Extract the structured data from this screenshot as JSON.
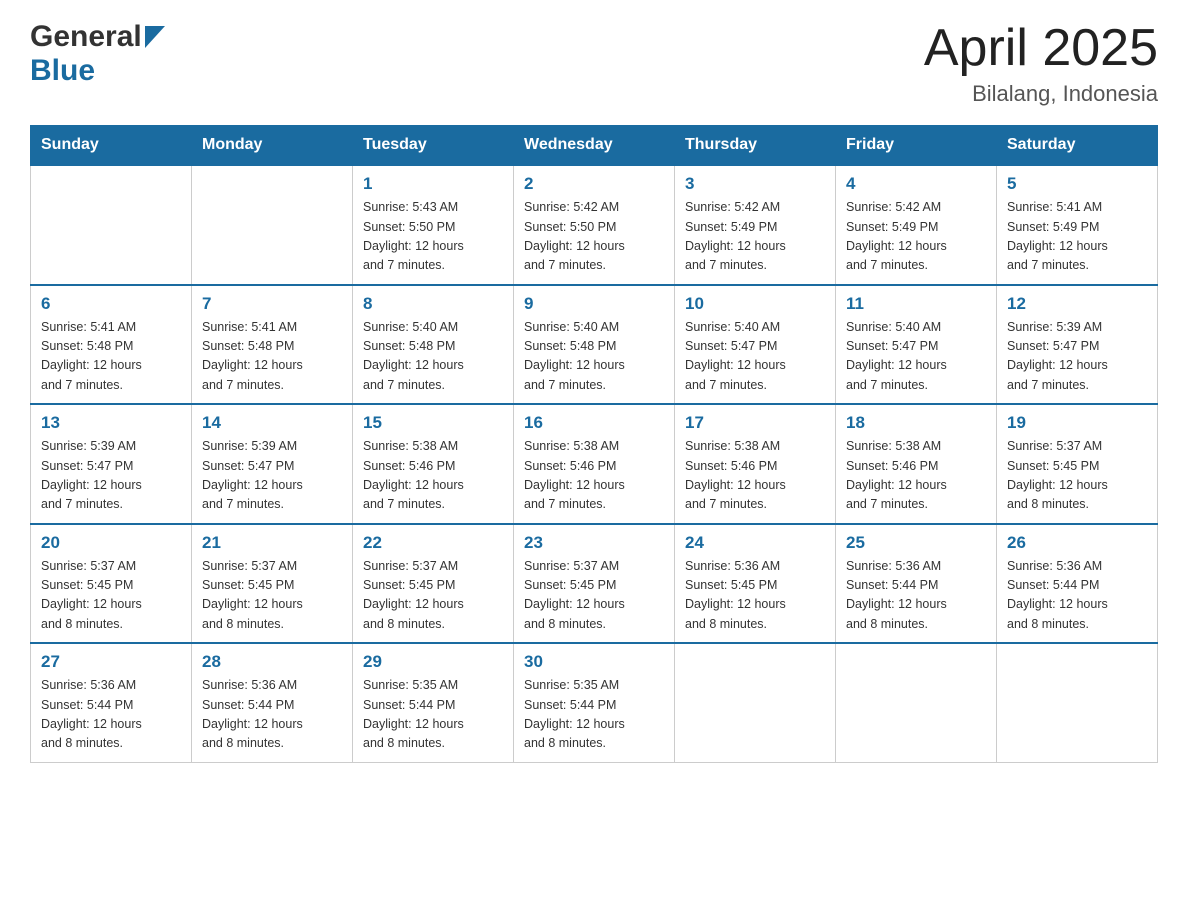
{
  "header": {
    "logo_general": "General",
    "logo_blue": "Blue",
    "title": "April 2025",
    "location": "Bilalang, Indonesia"
  },
  "days_of_week": [
    "Sunday",
    "Monday",
    "Tuesday",
    "Wednesday",
    "Thursday",
    "Friday",
    "Saturday"
  ],
  "weeks": [
    [
      {
        "day": "",
        "info": ""
      },
      {
        "day": "",
        "info": ""
      },
      {
        "day": "1",
        "info": "Sunrise: 5:43 AM\nSunset: 5:50 PM\nDaylight: 12 hours\nand 7 minutes."
      },
      {
        "day": "2",
        "info": "Sunrise: 5:42 AM\nSunset: 5:50 PM\nDaylight: 12 hours\nand 7 minutes."
      },
      {
        "day": "3",
        "info": "Sunrise: 5:42 AM\nSunset: 5:49 PM\nDaylight: 12 hours\nand 7 minutes."
      },
      {
        "day": "4",
        "info": "Sunrise: 5:42 AM\nSunset: 5:49 PM\nDaylight: 12 hours\nand 7 minutes."
      },
      {
        "day": "5",
        "info": "Sunrise: 5:41 AM\nSunset: 5:49 PM\nDaylight: 12 hours\nand 7 minutes."
      }
    ],
    [
      {
        "day": "6",
        "info": "Sunrise: 5:41 AM\nSunset: 5:48 PM\nDaylight: 12 hours\nand 7 minutes."
      },
      {
        "day": "7",
        "info": "Sunrise: 5:41 AM\nSunset: 5:48 PM\nDaylight: 12 hours\nand 7 minutes."
      },
      {
        "day": "8",
        "info": "Sunrise: 5:40 AM\nSunset: 5:48 PM\nDaylight: 12 hours\nand 7 minutes."
      },
      {
        "day": "9",
        "info": "Sunrise: 5:40 AM\nSunset: 5:48 PM\nDaylight: 12 hours\nand 7 minutes."
      },
      {
        "day": "10",
        "info": "Sunrise: 5:40 AM\nSunset: 5:47 PM\nDaylight: 12 hours\nand 7 minutes."
      },
      {
        "day": "11",
        "info": "Sunrise: 5:40 AM\nSunset: 5:47 PM\nDaylight: 12 hours\nand 7 minutes."
      },
      {
        "day": "12",
        "info": "Sunrise: 5:39 AM\nSunset: 5:47 PM\nDaylight: 12 hours\nand 7 minutes."
      }
    ],
    [
      {
        "day": "13",
        "info": "Sunrise: 5:39 AM\nSunset: 5:47 PM\nDaylight: 12 hours\nand 7 minutes."
      },
      {
        "day": "14",
        "info": "Sunrise: 5:39 AM\nSunset: 5:47 PM\nDaylight: 12 hours\nand 7 minutes."
      },
      {
        "day": "15",
        "info": "Sunrise: 5:38 AM\nSunset: 5:46 PM\nDaylight: 12 hours\nand 7 minutes."
      },
      {
        "day": "16",
        "info": "Sunrise: 5:38 AM\nSunset: 5:46 PM\nDaylight: 12 hours\nand 7 minutes."
      },
      {
        "day": "17",
        "info": "Sunrise: 5:38 AM\nSunset: 5:46 PM\nDaylight: 12 hours\nand 7 minutes."
      },
      {
        "day": "18",
        "info": "Sunrise: 5:38 AM\nSunset: 5:46 PM\nDaylight: 12 hours\nand 7 minutes."
      },
      {
        "day": "19",
        "info": "Sunrise: 5:37 AM\nSunset: 5:45 PM\nDaylight: 12 hours\nand 8 minutes."
      }
    ],
    [
      {
        "day": "20",
        "info": "Sunrise: 5:37 AM\nSunset: 5:45 PM\nDaylight: 12 hours\nand 8 minutes."
      },
      {
        "day": "21",
        "info": "Sunrise: 5:37 AM\nSunset: 5:45 PM\nDaylight: 12 hours\nand 8 minutes."
      },
      {
        "day": "22",
        "info": "Sunrise: 5:37 AM\nSunset: 5:45 PM\nDaylight: 12 hours\nand 8 minutes."
      },
      {
        "day": "23",
        "info": "Sunrise: 5:37 AM\nSunset: 5:45 PM\nDaylight: 12 hours\nand 8 minutes."
      },
      {
        "day": "24",
        "info": "Sunrise: 5:36 AM\nSunset: 5:45 PM\nDaylight: 12 hours\nand 8 minutes."
      },
      {
        "day": "25",
        "info": "Sunrise: 5:36 AM\nSunset: 5:44 PM\nDaylight: 12 hours\nand 8 minutes."
      },
      {
        "day": "26",
        "info": "Sunrise: 5:36 AM\nSunset: 5:44 PM\nDaylight: 12 hours\nand 8 minutes."
      }
    ],
    [
      {
        "day": "27",
        "info": "Sunrise: 5:36 AM\nSunset: 5:44 PM\nDaylight: 12 hours\nand 8 minutes."
      },
      {
        "day": "28",
        "info": "Sunrise: 5:36 AM\nSunset: 5:44 PM\nDaylight: 12 hours\nand 8 minutes."
      },
      {
        "day": "29",
        "info": "Sunrise: 5:35 AM\nSunset: 5:44 PM\nDaylight: 12 hours\nand 8 minutes."
      },
      {
        "day": "30",
        "info": "Sunrise: 5:35 AM\nSunset: 5:44 PM\nDaylight: 12 hours\nand 8 minutes."
      },
      {
        "day": "",
        "info": ""
      },
      {
        "day": "",
        "info": ""
      },
      {
        "day": "",
        "info": ""
      }
    ]
  ]
}
